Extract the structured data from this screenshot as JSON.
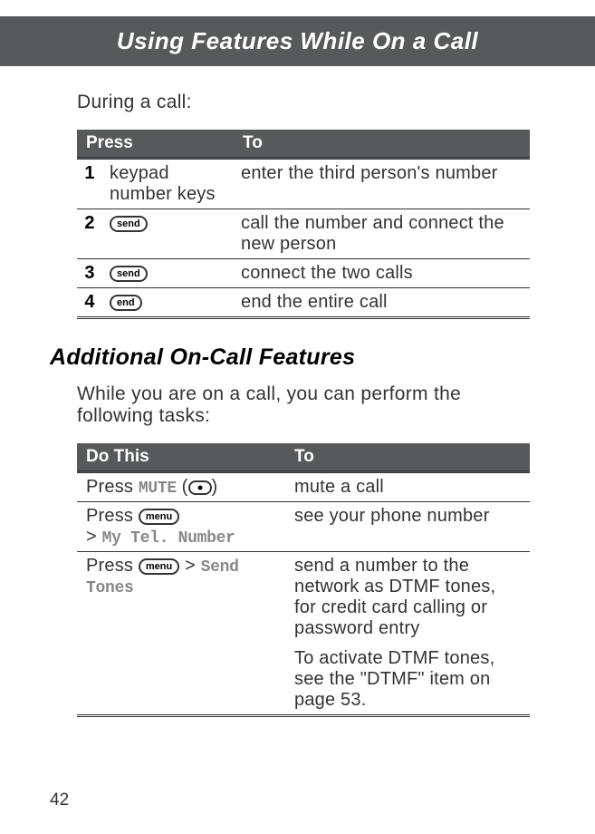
{
  "banner": {
    "title": "Using Features While On a Call"
  },
  "intro1": "During a call:",
  "table1": {
    "headers": {
      "press": "Press",
      "to": "To"
    },
    "rows": [
      {
        "num": "1",
        "press_text": "keypad number keys",
        "press_btn": "",
        "to": "enter the third person's number"
      },
      {
        "num": "2",
        "press_text": "",
        "press_btn": "send",
        "to": "call the number and connect the new person"
      },
      {
        "num": "3",
        "press_text": "",
        "press_btn": "send",
        "to": "connect the two calls"
      },
      {
        "num": "4",
        "press_text": "",
        "press_btn": "end",
        "to": "end the entire call"
      }
    ]
  },
  "section_heading": "Additional On-Call Features",
  "intro2": "While you are on a call, you can perform the following tasks:",
  "table2": {
    "headers": {
      "do": "Do This",
      "to": "To"
    },
    "rows": [
      {
        "do_prefix": "Press ",
        "do_mono1": "MUTE",
        "do_mid": " (",
        "do_suffix": ")",
        "to1": "mute a call"
      },
      {
        "do_prefix2": "Press ",
        "do_btn2": "menu",
        "do_line2": "> ",
        "do_mono2": "My Tel. Number",
        "to2": "see your phone number"
      },
      {
        "do_prefix3": "Press ",
        "do_btn3": "menu",
        "do_mid3": " > ",
        "do_mono3": "Send Tones",
        "to3a": "send a number to the network as DTMF tones, for credit card calling or password entry",
        "to3b": "To activate DTMF tones, see the \"DTMF\" item on page 53."
      }
    ]
  },
  "page_number": "42"
}
